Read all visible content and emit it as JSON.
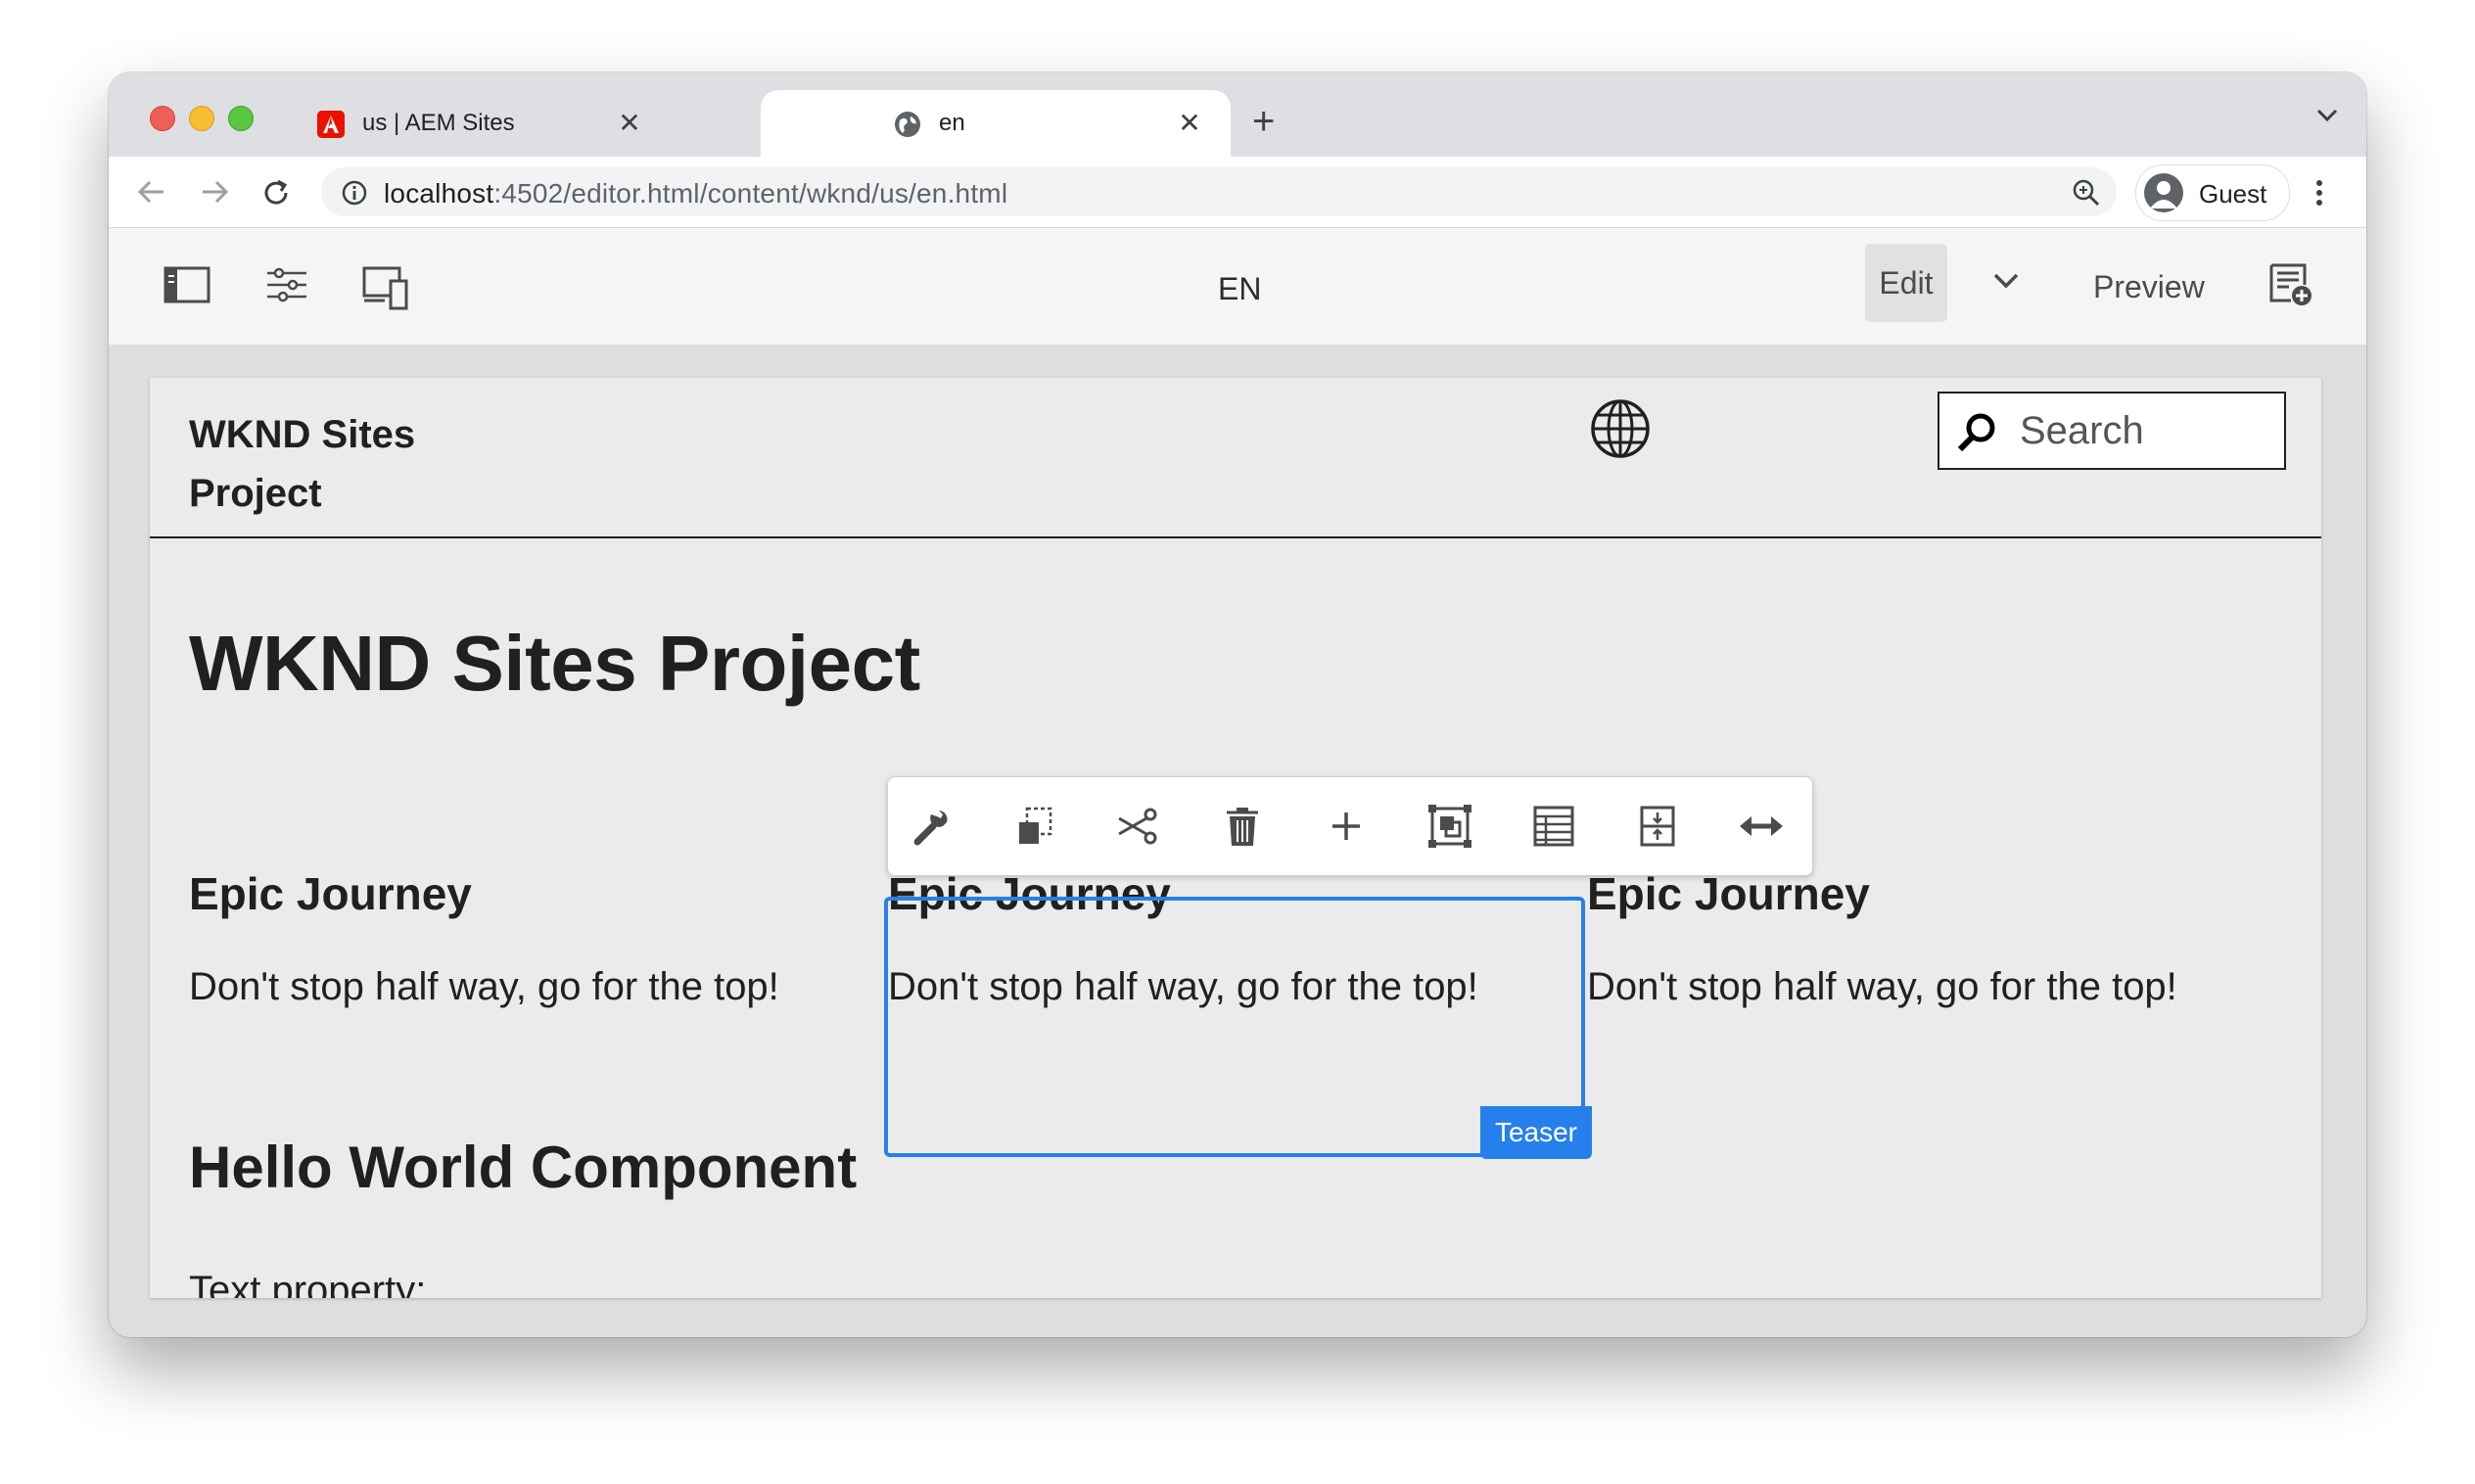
{
  "browser": {
    "tabs": [
      {
        "title": "us | AEM Sites",
        "favicon": "adobe-icon",
        "active": false
      },
      {
        "title": "en",
        "favicon": "globe-icon",
        "active": true
      }
    ],
    "tab_close_glyph": "✕",
    "new_tab_glyph": "+",
    "address": {
      "host": "localhost",
      "path": ":4502/editor.html/content/wknd/us/en.html"
    },
    "profile": {
      "name": "Guest"
    }
  },
  "aem_toolbar": {
    "page_title": "EN",
    "mode": "Edit",
    "preview_label": "Preview",
    "icons": [
      "side-panel-icon",
      "page-properties-icon",
      "emulator-icon",
      "annotations-icon"
    ]
  },
  "site": {
    "brand_line1": "WKND Sites",
    "brand_line2": "Project",
    "search_placeholder": "Search",
    "page_heading": "WKND Sites Project",
    "teasers": [
      {
        "title": "Epic Journey",
        "text": "Don't stop half way, go for the top!"
      },
      {
        "title": "Epic Journey",
        "text": "Don't stop half way, go for the top!"
      },
      {
        "title": "Epic Journey",
        "text": "Don't stop half way, go for the top!"
      }
    ],
    "hello_heading": "Hello World Component",
    "text_property_label": "Text property:"
  },
  "editor": {
    "selected_component": "Teaser",
    "accent_color": "#2680eb",
    "component_toolbar": [
      "configure",
      "copy",
      "cut",
      "delete",
      "insert",
      "group",
      "parent",
      "layout",
      "layout-mode"
    ]
  }
}
